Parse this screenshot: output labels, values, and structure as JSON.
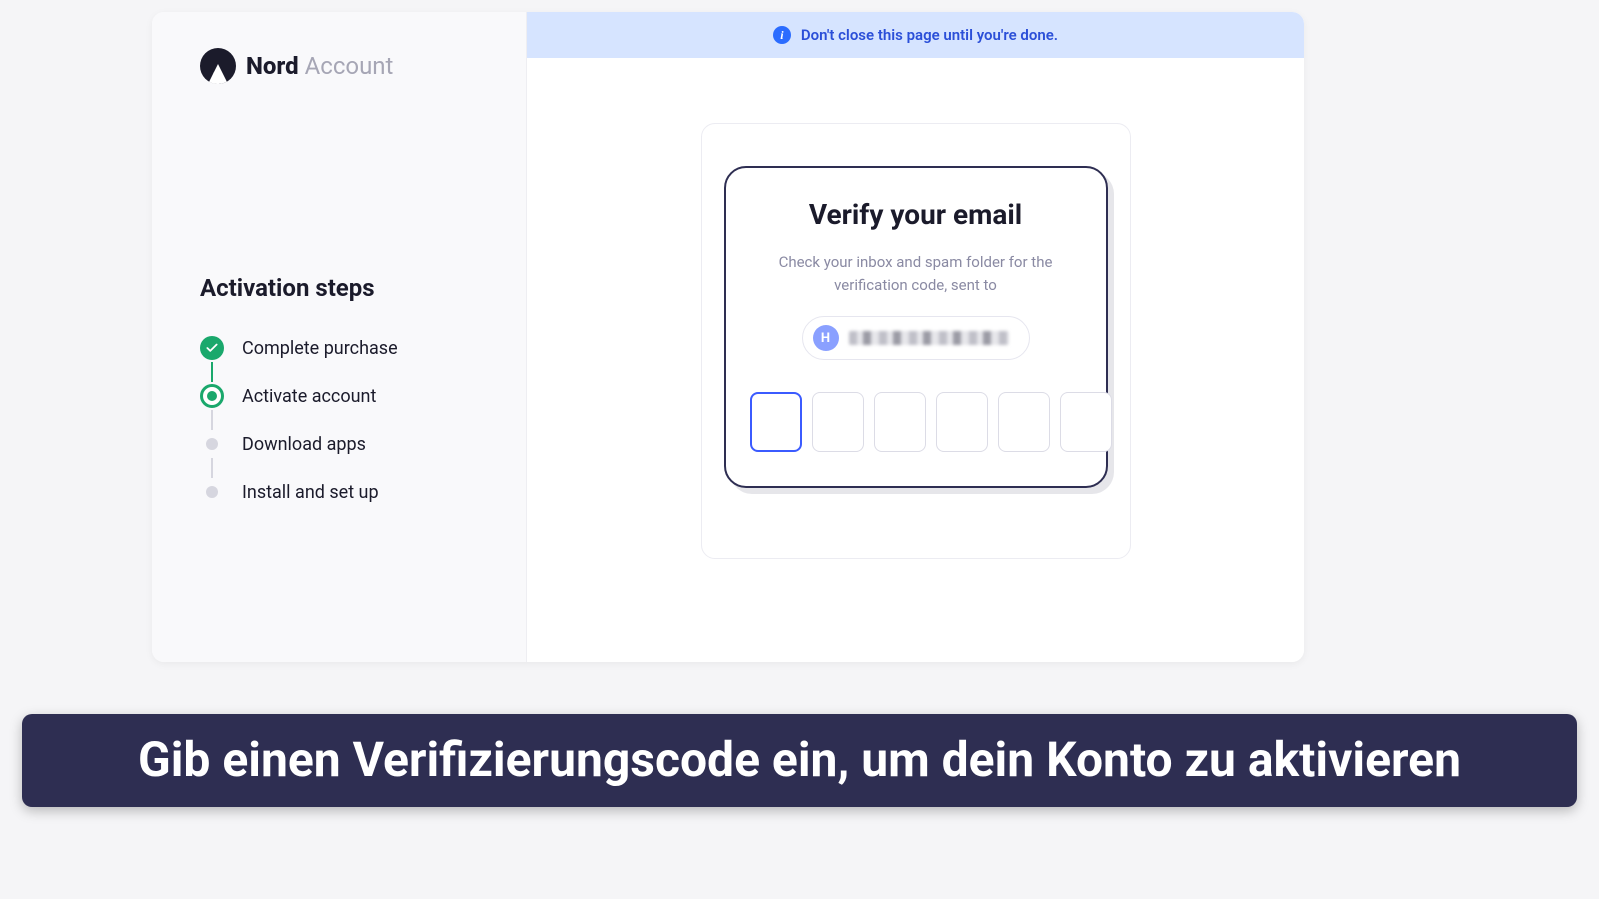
{
  "brand": {
    "bold": "Nord",
    "light": "Account"
  },
  "sidebar": {
    "title": "Activation steps",
    "steps": [
      {
        "label": "Complete purchase",
        "state": "done"
      },
      {
        "label": "Activate account",
        "state": "active"
      },
      {
        "label": "Download apps",
        "state": "pending"
      },
      {
        "label": "Install and set up",
        "state": "pending"
      }
    ]
  },
  "notice": {
    "text": "Don't close this page until you're done."
  },
  "verify": {
    "title": "Verify your email",
    "subtitle": "Check your inbox and spam folder for the verification code, sent to",
    "avatar_initial": "H",
    "code_length": 6
  },
  "caption": "Gib einen Verifizierungscode ein, um dein Konto zu aktivieren"
}
